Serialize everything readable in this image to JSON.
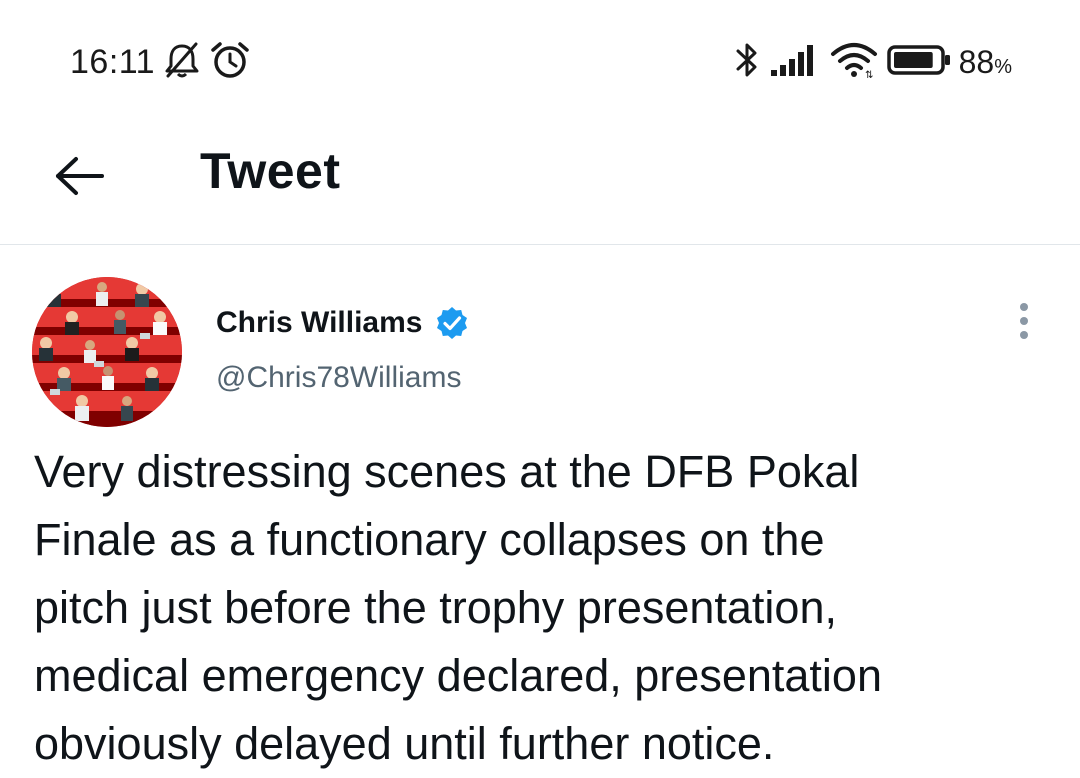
{
  "status_bar": {
    "time": "16:11",
    "icons_left": [
      "bell-off-icon",
      "alarm-icon"
    ],
    "icons_right": [
      "bluetooth-icon",
      "signal-icon",
      "wifi-icon",
      "battery-icon"
    ],
    "battery_percent": "88",
    "battery_percent_sign": "%",
    "battery_level": 0.88
  },
  "header": {
    "back_icon": "back-arrow-icon",
    "title": "Tweet"
  },
  "tweet": {
    "author_name": "Chris Williams",
    "verified": true,
    "verified_color": "#1d9bf0",
    "author_handle": "@Chris78Williams",
    "more_icon": "more-vertical-icon",
    "lines": [
      "Very distressing scenes at the DFB Pokal",
      "Finale as a functionary collapses on the",
      "pitch just before the trophy presentation,",
      "medical emergency declared, presentation",
      "obviously delayed until further notice."
    ]
  },
  "colors": {
    "text_primary": "#0f1419",
    "text_secondary": "#536471",
    "divider": "#e1e6ea",
    "avatar_seat_red": "#d9262c"
  }
}
